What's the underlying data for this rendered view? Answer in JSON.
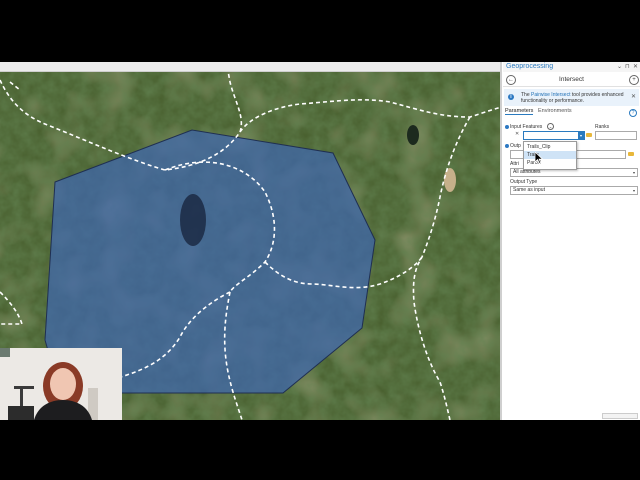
{
  "pane": {
    "title": "Geoprocessing",
    "header_buttons": [
      "⌄",
      "⊓",
      "✕"
    ],
    "tool_name": "Intersect",
    "back_label": "←",
    "add_label": "+",
    "info": {
      "prefix": "The ",
      "link": "Pairwise Intersect",
      "suffix": " tool provides enhanced functionality or performance.",
      "close": "✕"
    },
    "tabs": {
      "parameters": "Parameters",
      "environments": "Environments"
    },
    "help": "?",
    "input_features": {
      "label": "Input Features",
      "ranks_label": "Ranks",
      "value": "",
      "dropdown_options": [
        "Trails_Clip",
        "Trails",
        "Parcel"
      ],
      "highlighted": "Trails"
    },
    "output_label": "Outp",
    "attributes": {
      "label": "Attri",
      "value": "All attributes"
    },
    "output_type": {
      "label": "Output Type",
      "value": "Same as input"
    },
    "remove_icon": "✕"
  },
  "colors": {
    "accent": "#2a7abf",
    "polygon_fill": "#3f67b0",
    "map_dark": "#2f4a24",
    "map_light": "#8b8560"
  }
}
